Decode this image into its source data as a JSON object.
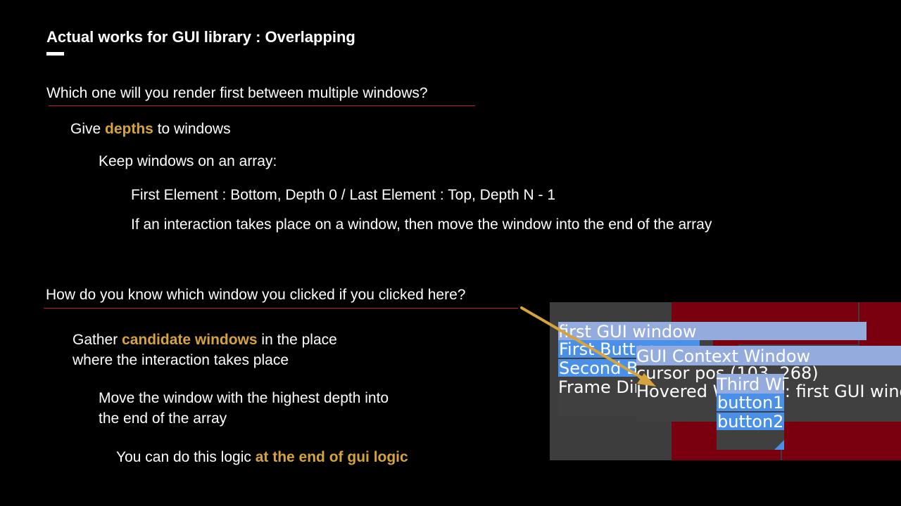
{
  "slide": {
    "title": "Actual works for GUI library : Overlapping"
  },
  "section1": {
    "question": "Which one will you render first between multiple windows?",
    "give_prefix": "Give ",
    "give_accent": "depths",
    "give_suffix": " to windows",
    "keep": "Keep windows on an array:",
    "first_last": "First Element : Bottom, Depth 0  / Last Element : Top, Depth N - 1",
    "interaction": "If an interaction takes place on a window, then move the window into the end of the array"
  },
  "section2": {
    "question": "How do you know which window you clicked if you clicked here?",
    "gather_prefix": "Gather ",
    "gather_accent": "candidate windows",
    "gather_suffix": " in the place",
    "gather_line2": "where the interaction takes place",
    "move_line1": "Move the window with the highest depth into",
    "move_line2": "the end of the array",
    "logic_prefix": "You can do this logic ",
    "logic_accent": "at the end of gui logic"
  },
  "demo": {
    "window1": {
      "title": "first GUI window",
      "button1": "First Button",
      "button2": "Second Button",
      "frame_label": "Frame Dimensions"
    },
    "window2": {
      "title": "GUI Context Window",
      "cursor": "cursor pos (103, 268)",
      "hovered": "Hovered Window : first GUI window"
    },
    "window3": {
      "title": "Third Window",
      "button1": "button1",
      "button2": "button2"
    }
  },
  "colors": {
    "accent": "#d6a43b",
    "underline": "#c0202c",
    "arrow": "#d6a43b",
    "window_title": "#94acdd",
    "button": "#4a90e8",
    "background_red": "#7a0010"
  }
}
